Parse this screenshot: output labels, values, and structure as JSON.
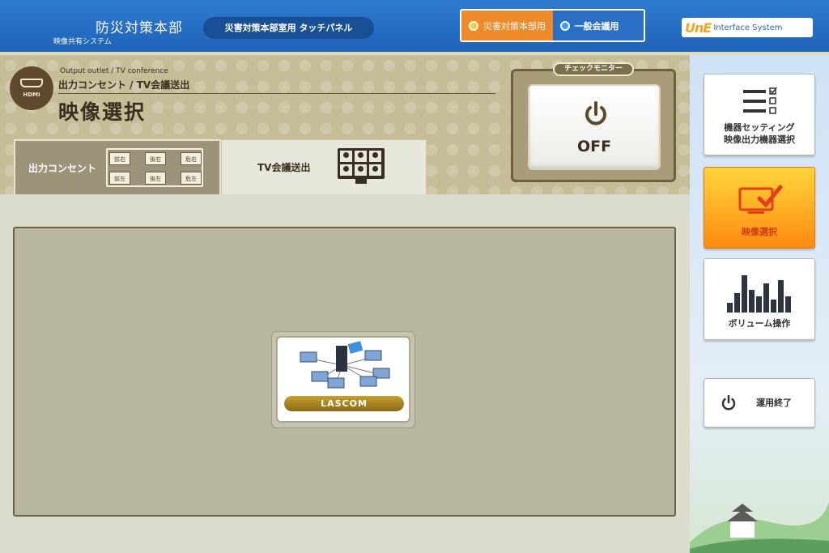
{
  "header": {
    "title": "防災対策本部",
    "subtitle": "映像共有システム",
    "panel_label": "災害対策本部室用 タッチパネル",
    "modes": [
      {
        "label": "災害対策本部用",
        "active": true
      },
      {
        "label": "一般会議用",
        "active": false
      }
    ],
    "brand_logo": "UnE",
    "brand_text": "Interface System"
  },
  "main": {
    "hdmi_label": "HDMI",
    "breadcrumb_en": "Output outlet / TV conference",
    "breadcrumb_jp": "出力コンセント / TV会議送出",
    "page_title": "映像選択",
    "tabs": [
      {
        "label": "出力コンセント",
        "active": false
      },
      {
        "label": "TV会議送出",
        "active": true
      }
    ],
    "outlets": [
      "前右",
      "後右",
      "危右",
      "前左",
      "後左",
      "危左"
    ],
    "check_monitor": {
      "label": "チェックモニター",
      "state": "OFF"
    },
    "sources": [
      {
        "label": "LASCOM"
      }
    ]
  },
  "sidebar": {
    "buttons": [
      {
        "label_line1": "機器セッティング",
        "label_line2": "映像出力機器選択"
      },
      {
        "label": "映像選択",
        "active": true
      },
      {
        "label": "ボリューム操作"
      },
      {
        "label": "運用終了"
      }
    ]
  },
  "colors": {
    "header_blue": "#1f63b8",
    "active_mode": "#ef8a2a",
    "gold_dark": "#3a2e1e",
    "sidebar_active": "#ffb020"
  }
}
